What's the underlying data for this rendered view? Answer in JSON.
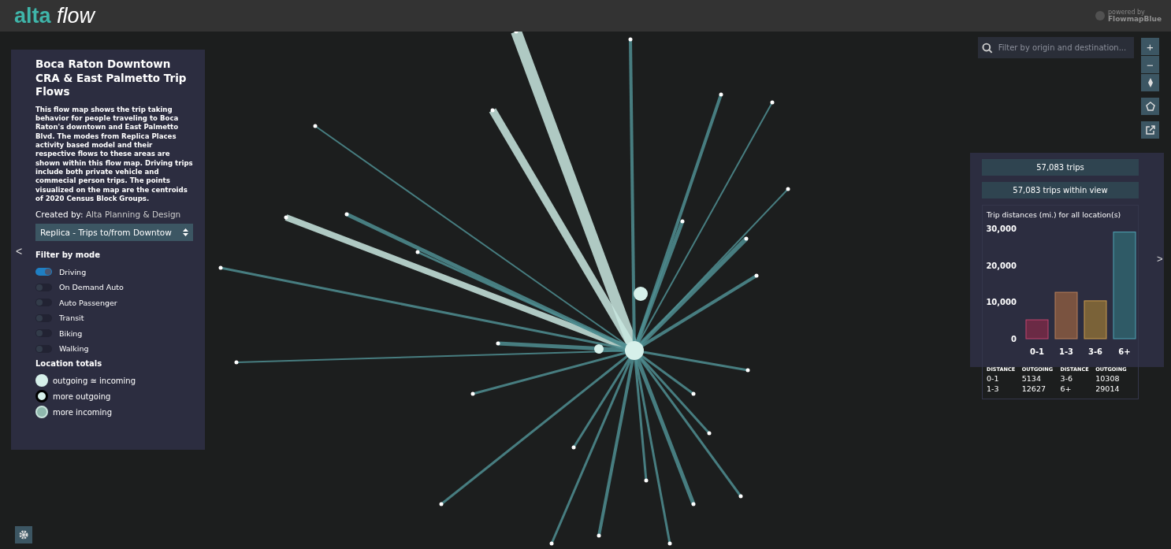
{
  "header": {
    "logo_bold": "alta",
    "logo_italic": "flow",
    "powered_by": "powered by",
    "powered_brand": "FlowmapBlue"
  },
  "info_panel": {
    "title": "Boca Raton Downtown CRA & East Palmetto Trip Flows",
    "description": "This flow map shows the trip taking behavior for people traveling to Boca Raton's downtown and East Palmetto Blvd. The modes from Replica Places activity based model and their respective flows to these areas are shown within this flow map. Driving trips include both private vehicle and commecial person trips. The points visualized on the map are the centroids of 2020 Census Block Groups.",
    "created_by_label": "Created by:",
    "created_by": "Alta Planning & Design",
    "dataset_select": "Replica - Trips to/from Downtow",
    "filter_heading": "Filter by mode",
    "modes": [
      {
        "label": "Driving",
        "on": true
      },
      {
        "label": "On Demand Auto",
        "on": false
      },
      {
        "label": "Auto Passenger",
        "on": false
      },
      {
        "label": "Transit",
        "on": false
      },
      {
        "label": "Biking",
        "on": false
      },
      {
        "label": "Walking",
        "on": false
      }
    ],
    "legend_heading": "Location totals",
    "legend": [
      {
        "kind": "equal",
        "label": "outgoing ≅ incoming"
      },
      {
        "kind": "outgoing",
        "label": "more outgoing"
      },
      {
        "kind": "incoming",
        "label": "more incoming"
      }
    ],
    "collapse": "<"
  },
  "search": {
    "placeholder": "Filter by origin and destination..."
  },
  "map_controls": [
    "+",
    "−"
  ],
  "stats_panel": {
    "total": "57,083 trips",
    "in_view": "57,083 trips within view",
    "expand": ">",
    "chart_data": {
      "type": "bar",
      "title": "Trip distances (mi.) for all location(s)",
      "categories": [
        "0-1",
        "1-3",
        "3-6",
        "6+"
      ],
      "values": [
        5134,
        12627,
        10308,
        29014
      ],
      "yticks": [
        {
          "value": 0,
          "label": "0"
        },
        {
          "value": 10000,
          "label": "10,000"
        },
        {
          "value": 20000,
          "label": "20,000"
        },
        {
          "value": 30000,
          "label": "30,000"
        }
      ],
      "ylim": [
        0,
        30000
      ]
    },
    "table": {
      "columns": [
        "DISTANCE",
        "OUTGOING",
        "DISTANCE",
        "OUTGOING"
      ],
      "rows": [
        [
          "0-1",
          "5134",
          "3-6",
          "10308"
        ],
        [
          "1-3",
          "12627",
          "6+",
          "29014"
        ]
      ]
    }
  }
}
